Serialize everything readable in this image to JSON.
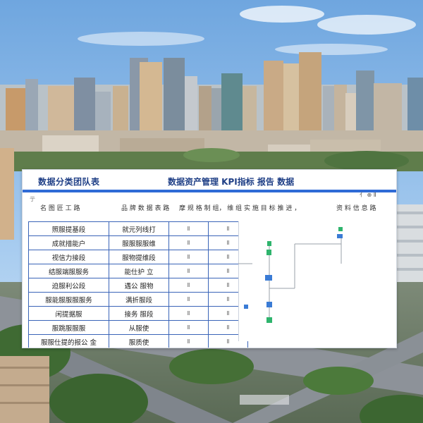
{
  "document": {
    "title_left": "数据分类团队表",
    "title_center": "数据资产管理 KPI指标  报告 数据",
    "corner_marks": "亻 ⊕ Ⅱ",
    "left_marks": "亍",
    "subheader": {
      "left": "名 图 匠 工 路",
      "center": "品 牌 数 据 表 路",
      "right": "摩 规 格 制 组，   维 组 实 施 目 标 推 进 ，",
      "far_right": "资 料 信 息 路"
    },
    "rows": [
      {
        "c1": "照服提基段",
        "c2": "就元列线打",
        "c3": "Ⅱ",
        "c4": "Ⅱ"
      },
      {
        "c1": "成就措能户",
        "c2": "服服服服维",
        "c3": "Ⅱ",
        "c4": "Ⅱ"
      },
      {
        "c1": "视信力接段",
        "c2": "服物提维段",
        "c3": "Ⅱ",
        "c4": "Ⅱ"
      },
      {
        "c1": "结服端服服务",
        "c2": "能仕护 立",
        "c3": "Ⅱ",
        "c4": "Ⅱ"
      },
      {
        "c1": "迫服利公段",
        "c2": "遇公 服物",
        "c3": "Ⅱ",
        "c4": "Ⅱ"
      },
      {
        "c1": "服能服服服服务",
        "c2": "满折服段",
        "c3": "Ⅱ",
        "c4": "Ⅱ"
      },
      {
        "c1": "闲提据服",
        "c2": "接务 服段",
        "c3": "Ⅱ",
        "c4": "Ⅱ"
      },
      {
        "c1": "服跳服服服",
        "c2": "从服使",
        "c3": "Ⅱ",
        "c4": "Ⅱ"
      },
      {
        "c1": "服服仕提的报公 金",
        "c2": "服质使",
        "c3": "Ⅱ",
        "c4": "Ⅱ"
      }
    ]
  },
  "colors": {
    "sky": "#8db8e6",
    "accent": "#2f6bd6",
    "title": "#1f3f86",
    "border": "#3a64b8",
    "flow_green": "#2fb46d",
    "flow_blue": "#3a7bd5"
  }
}
